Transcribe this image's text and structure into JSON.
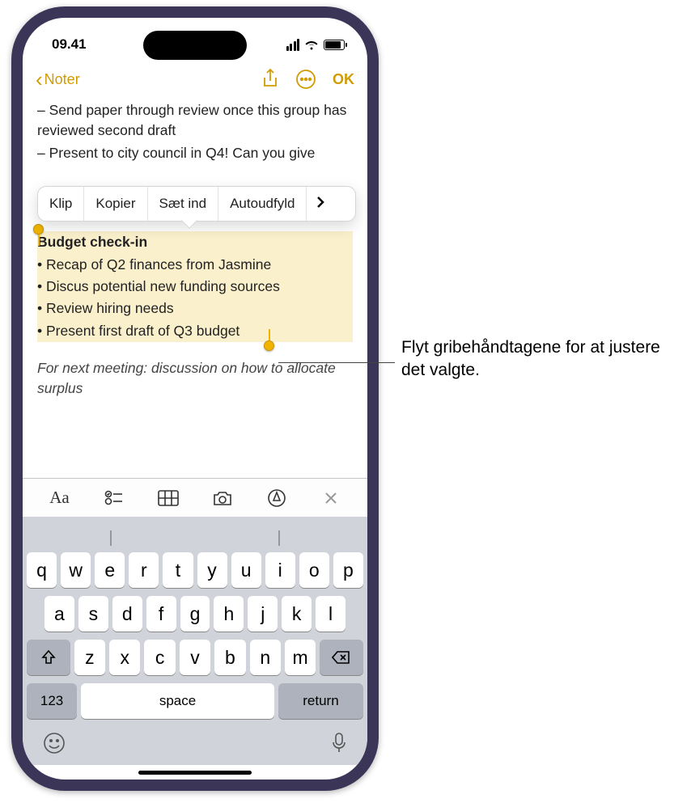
{
  "status": {
    "time": "09.41"
  },
  "nav": {
    "back_label": "Noter",
    "ok_label": "OK"
  },
  "edit_menu": {
    "items": [
      "Klip",
      "Kopier",
      "Sæt ind",
      "Autoudfyld"
    ]
  },
  "note": {
    "pre_lines": [
      "– Send paper through review once this group has reviewed second draft",
      "– Present to city council in Q4! Can you give"
    ],
    "selection": {
      "heading": "Budget check-in",
      "bullets": [
        "Recap of Q2 finances from Jasmine",
        "Discus potential new funding sources",
        "Review hiring needs",
        "Present first draft of Q3 budget"
      ]
    },
    "italic_line": "For next meeting: discussion on how to allocate surplus"
  },
  "keyboard": {
    "row1": [
      "q",
      "w",
      "e",
      "r",
      "t",
      "y",
      "u",
      "i",
      "o",
      "p"
    ],
    "row2": [
      "a",
      "s",
      "d",
      "f",
      "g",
      "h",
      "j",
      "k",
      "l"
    ],
    "row3": [
      "z",
      "x",
      "c",
      "v",
      "b",
      "n",
      "m"
    ],
    "num_label": "123",
    "space_label": "space",
    "return_label": "return"
  },
  "callout": {
    "text": "Flyt gribehåndtagene for at justere det valgte."
  },
  "colors": {
    "accent": "#d19b02",
    "selection": "#faf0cc"
  }
}
